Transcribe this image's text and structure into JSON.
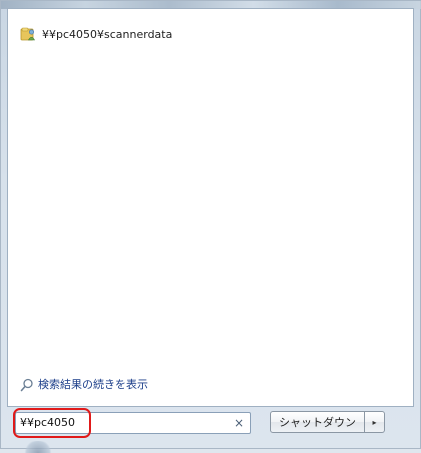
{
  "results": [
    {
      "label": "¥¥pc4050¥scannerdata",
      "icon": "shared-folder-icon"
    }
  ],
  "see_more": {
    "label": "検索結果の続きを表示",
    "icon": "search-icon"
  },
  "search": {
    "value": "¥¥pc4050",
    "clear_glyph": "×"
  },
  "shutdown": {
    "label": "シャットダウン",
    "arrow_glyph": "▸"
  },
  "colors": {
    "highlight": "#e01a1a",
    "link": "#1d3f8a"
  }
}
